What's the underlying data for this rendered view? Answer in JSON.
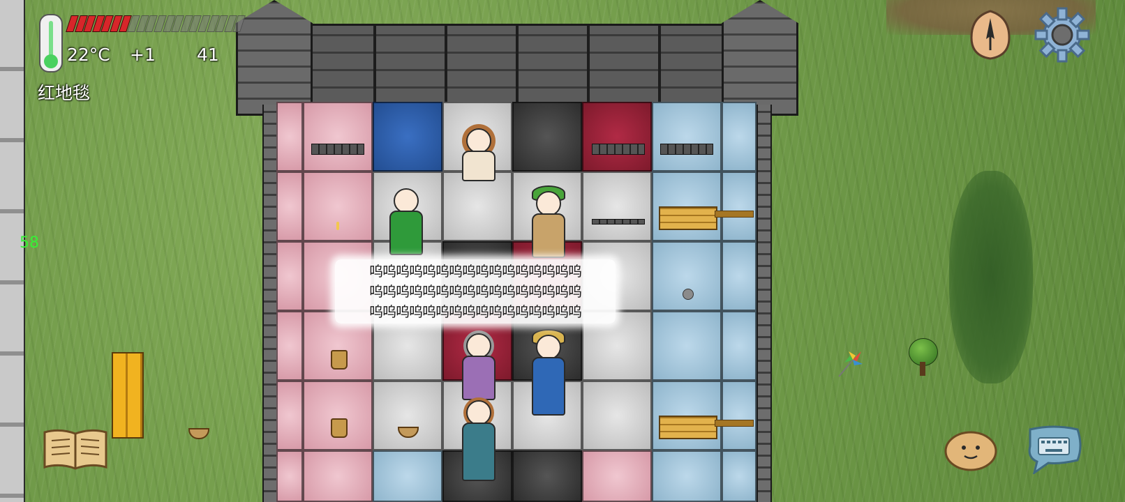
{
  "hud": {
    "temperature": "22°C",
    "temp_delta": "+1",
    "age": "41",
    "hovered_object": "红地毯",
    "fps": "58",
    "food_pips_total": 20,
    "food_pips_filled": 7
  },
  "speech": {
    "lines": [
      "呜呜呜呜呜呜呜呜呜呜呜呜呜呜呜呜",
      "呜呜呜呜呜呜呜呜呜呜呜呜呜呜呜呜",
      "呜呜呜呜呜呜呜呜呜呜呜呜呜呜呜呜"
    ]
  },
  "icons": {
    "compass": "compass-icon",
    "settings": "gear-icon",
    "tech_tree": "book-icon",
    "emote": "potato-face-icon",
    "chat": "keyboard-bubble-icon",
    "thermometer": "thermometer-icon"
  },
  "colors": {
    "fps_green": "#37f036",
    "food_red": "#d8262a"
  }
}
